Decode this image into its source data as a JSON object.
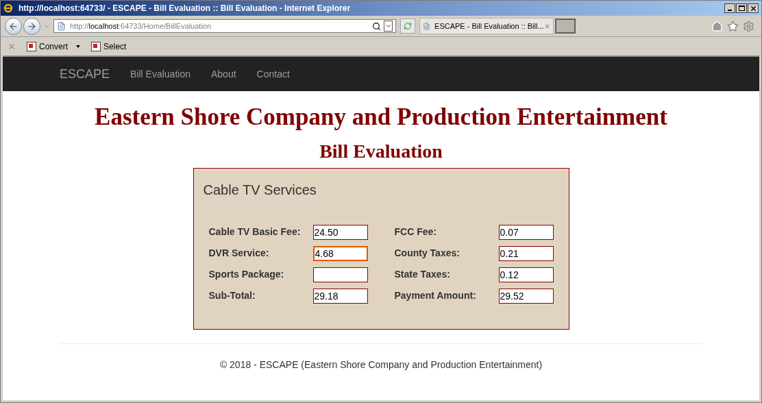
{
  "window": {
    "title": "http://localhost:64733/ - ESCAPE - Bill Evaluation :: Bill Evaluation - Internet Explorer"
  },
  "address_bar": {
    "url_prefix": "http://",
    "url_host": "localhost",
    "url_rest": ":64733/Home/BillEvaluation"
  },
  "tabs": [
    {
      "label": "ESCAPE - Bill Evaluation :: Bill...",
      "selected": true
    }
  ],
  "command_bar": {
    "items": [
      "Convert",
      "Select"
    ]
  },
  "navbar": {
    "brand": "ESCAPE",
    "links": [
      "Bill Evaluation",
      "About",
      "Contact"
    ]
  },
  "page": {
    "heading": "Eastern Shore Company and Production Entertainment",
    "subheading": "Bill Evaluation"
  },
  "panel": {
    "title": "Cable TV Services",
    "left_fields": [
      {
        "label": "Cable TV Basic Fee:",
        "value": "24.50",
        "focused": false
      },
      {
        "label": "DVR Service:",
        "value": "4.68",
        "focused": true
      },
      {
        "label": "Sports Package:",
        "focused": false
      },
      {
        "label": "Sub-Total:",
        "value": "29.18",
        "focused": false
      }
    ],
    "right_fields": [
      {
        "label": "FCC Fee:",
        "value": "0.07",
        "focused": false
      },
      {
        "label": "County Taxes:",
        "value": "0.21",
        "focused": false
      },
      {
        "label": "State Taxes:",
        "value": "0.12",
        "focused": false
      },
      {
        "label": "Payment Amount:",
        "value": "29.52",
        "focused": false
      }
    ]
  },
  "footer": {
    "text": "© 2018 - ESCAPE (Eastern Shore Company and Production Entertainment)"
  }
}
